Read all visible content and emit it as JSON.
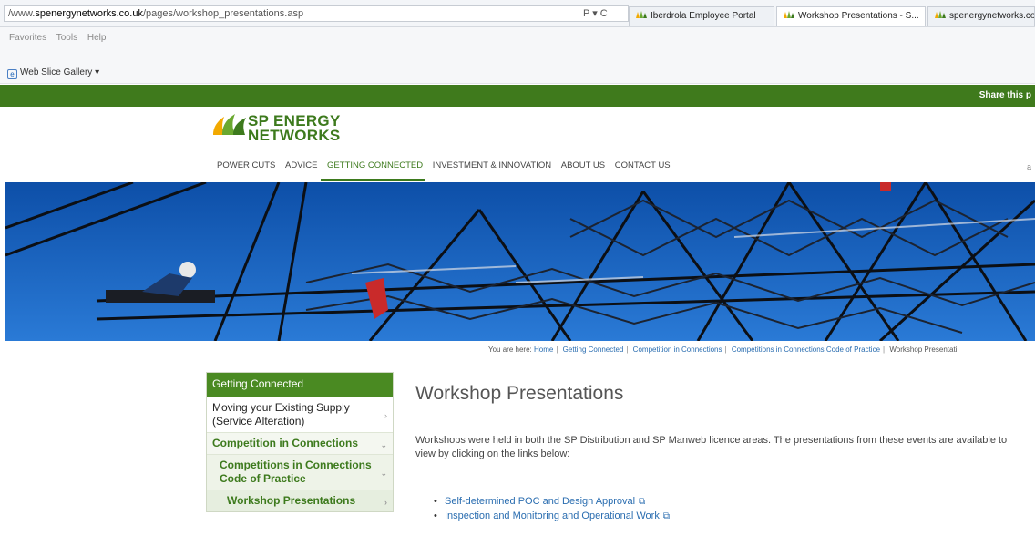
{
  "browser": {
    "url_prefix": "/www.",
    "url_domain": "spenergynetworks.co.uk",
    "url_path": "/pages/workshop_presentations.asp",
    "url_controls": "P ▾ C",
    "tabs": [
      {
        "label": "Iberdrola Employee Portal",
        "active": false
      },
      {
        "label": "Workshop Presentations - S...",
        "active": true
      },
      {
        "label": "spenergynetworks.co..",
        "active": false
      }
    ],
    "tab_close": "×",
    "menu": [
      "Favorites",
      "Tools",
      "Help"
    ],
    "web_slice": "Web Slice Gallery ▾"
  },
  "site": {
    "share": "Share this p",
    "logo_line1": "SP ENERGY",
    "logo_line2": "NETWORKS",
    "nav": [
      "POWER CUTS",
      "ADVICE",
      "GETTING CONNECTED",
      "INVESTMENT & INNOVATION",
      "ABOUT US",
      "CONTACT US"
    ],
    "nav_right": "a",
    "breadcrumb": {
      "prefix": "You are here:",
      "items": [
        "Home",
        "Getting Connected",
        "Competition in Connections",
        "Competitions in Connections Code of Practice",
        "Workshop Presentati"
      ],
      "separator": "|"
    }
  },
  "sidebar": {
    "heading": "Getting Connected",
    "items": [
      {
        "label": "Moving your Existing Supply (Service Alteration)",
        "chevron": "›"
      },
      {
        "label": "Competition in Connections",
        "chevron": "⌄"
      },
      {
        "label": "Competitions in Connections Code of Practice",
        "chevron": "⌄"
      },
      {
        "label": "Workshop Presentations",
        "chevron": "›"
      }
    ]
  },
  "main": {
    "title": "Workshop Presentations",
    "intro": "Workshops were held in both the SP Distribution and SP Manweb licence areas.  The presentations from these events are available to view by clicking on the links below:",
    "links": [
      "Self-determined POC and Design Approval",
      "Inspection and Monitoring and Operational Work"
    ],
    "external_icon": "⧉"
  },
  "colors": {
    "brand_green": "#3d7a1d",
    "link_blue": "#2a6db0"
  }
}
